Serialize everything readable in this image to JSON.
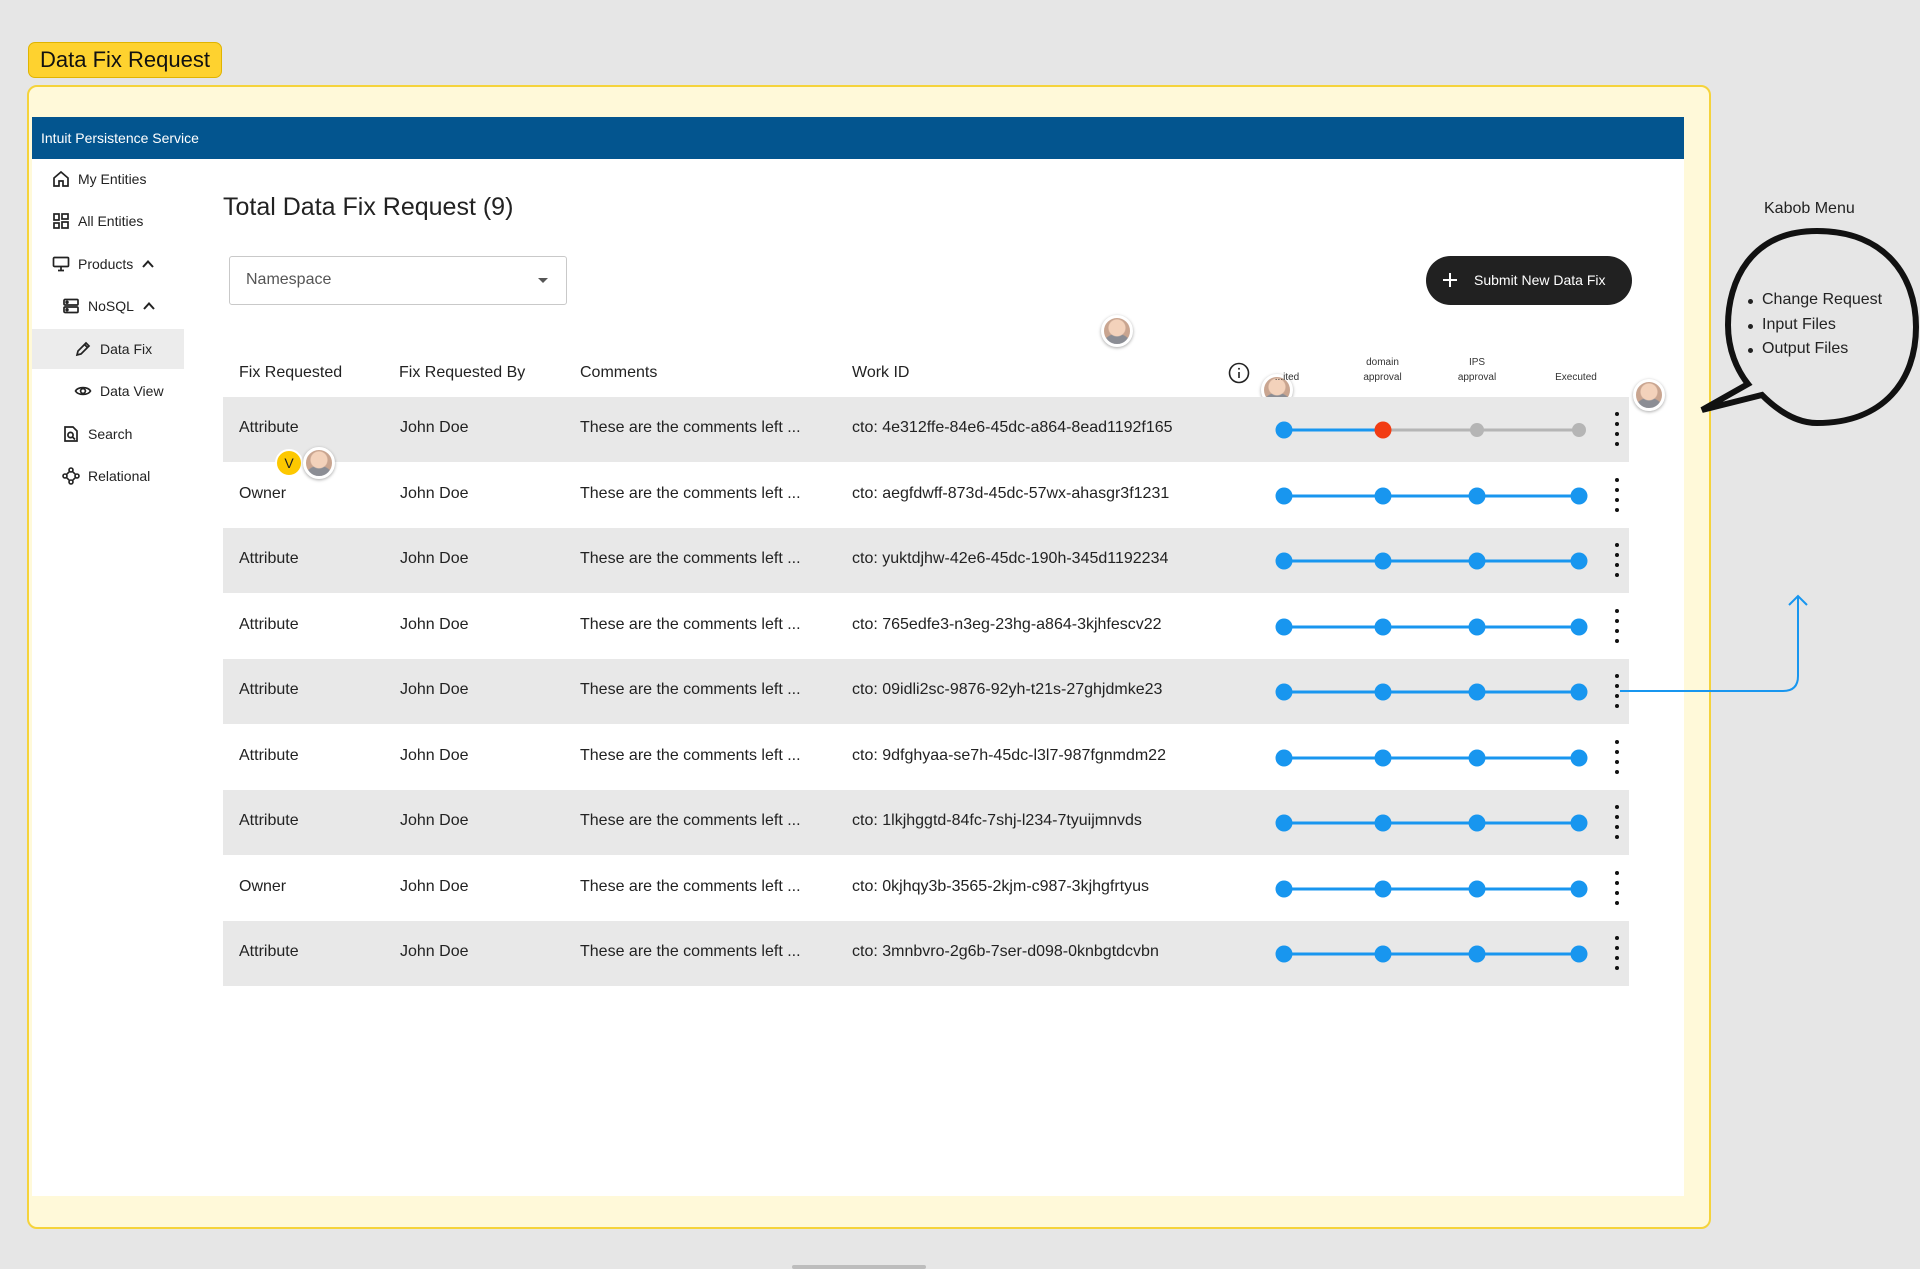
{
  "frame_label": "Data Fix Request",
  "app": {
    "title": "Intuit Persistence Service"
  },
  "sidebar": {
    "items": [
      {
        "label": "My Entities",
        "icon": "home-icon"
      },
      {
        "label": "All Entities",
        "icon": "grid-icon"
      },
      {
        "label": "Products",
        "icon": "monitor-icon"
      },
      {
        "label": "NoSQL",
        "icon": "server-icon"
      },
      {
        "label": "Data Fix",
        "icon": "pencil-icon"
      },
      {
        "label": "Data View",
        "icon": "eye-icon"
      },
      {
        "label": "Search",
        "icon": "search-icon"
      },
      {
        "label": "Relational",
        "icon": "network-icon"
      }
    ]
  },
  "main": {
    "title": "Total Data Fix Request (9)",
    "namespace_placeholder": "Namespace",
    "submit_label": "Submit New Data Fix"
  },
  "table": {
    "headers": [
      "Fix Requested",
      "Fix Requested By",
      "Comments",
      "Work ID"
    ],
    "steps": [
      "...ited",
      "domain approval",
      "IPS approval",
      "Executed"
    ],
    "rows": [
      {
        "fix": "Attribute",
        "by": "John Doe",
        "comments": "These are the comments left ...",
        "work_id": "cto: 4e312ffe-84e6-45dc-a864-8ead1192f165",
        "steps": [
          "done",
          "rejected",
          "pending",
          "pending"
        ]
      },
      {
        "fix": "Owner",
        "by": "John Doe",
        "comments": "These are the comments left ...",
        "work_id": "cto: aegfdwff-873d-45dc-57wx-ahasgr3f1231",
        "steps": [
          "done",
          "done",
          "done",
          "done"
        ]
      },
      {
        "fix": "Attribute",
        "by": "John Doe",
        "comments": "These are the comments left ...",
        "work_id": "cto: yuktdjhw-42e6-45dc-190h-345d1192234",
        "steps": [
          "done",
          "done",
          "done",
          "done"
        ]
      },
      {
        "fix": "Attribute",
        "by": "John Doe",
        "comments": "These are the comments left ...",
        "work_id": "cto: 765edfe3-n3eg-23hg-a864-3kjhfescv22",
        "steps": [
          "done",
          "done",
          "done",
          "done"
        ]
      },
      {
        "fix": "Attribute",
        "by": "John Doe",
        "comments": "These are the comments left ...",
        "work_id": "cto: 09idli2sc-9876-92yh-t21s-27ghjdmke23",
        "steps": [
          "done",
          "done",
          "done",
          "done"
        ]
      },
      {
        "fix": "Attribute",
        "by": "John Doe",
        "comments": "These are the comments left ...",
        "work_id": "cto: 9dfghyaa-se7h-45dc-l3l7-987fgnmdm22",
        "steps": [
          "done",
          "done",
          "done",
          "done"
        ]
      },
      {
        "fix": "Attribute",
        "by": "John Doe",
        "comments": "These are the comments left ...",
        "work_id": "cto: 1lkjhggtd-84fc-7shj-l234-7tyuijmnvds",
        "steps": [
          "done",
          "done",
          "done",
          "done"
        ]
      },
      {
        "fix": "Owner",
        "by": "John Doe",
        "comments": "These are the comments left ...",
        "work_id": "cto: 0kjhqy3b-3565-2kjm-c987-3kjhgfrtyus",
        "steps": [
          "done",
          "done",
          "done",
          "done"
        ]
      },
      {
        "fix": "Attribute",
        "by": "John Doe",
        "comments": "These are the comments left ...",
        "work_id": "cto: 3mnbvro-2g6b-7ser-d098-0knbgtdcvbn",
        "steps": [
          "done",
          "done",
          "done",
          "done"
        ]
      }
    ]
  },
  "annotation": {
    "title": "Kabob Menu",
    "items": [
      "Change Request",
      "Input Files",
      "Output Files"
    ]
  },
  "collaborator_badge": "V",
  "colors": {
    "frame_yellow": "#fed22f",
    "app_bar": "#03558f",
    "step_done": "#1896ef",
    "step_rejected": "#f23c13",
    "step_pending": "#b5b5b5",
    "button_dark": "#212121"
  }
}
